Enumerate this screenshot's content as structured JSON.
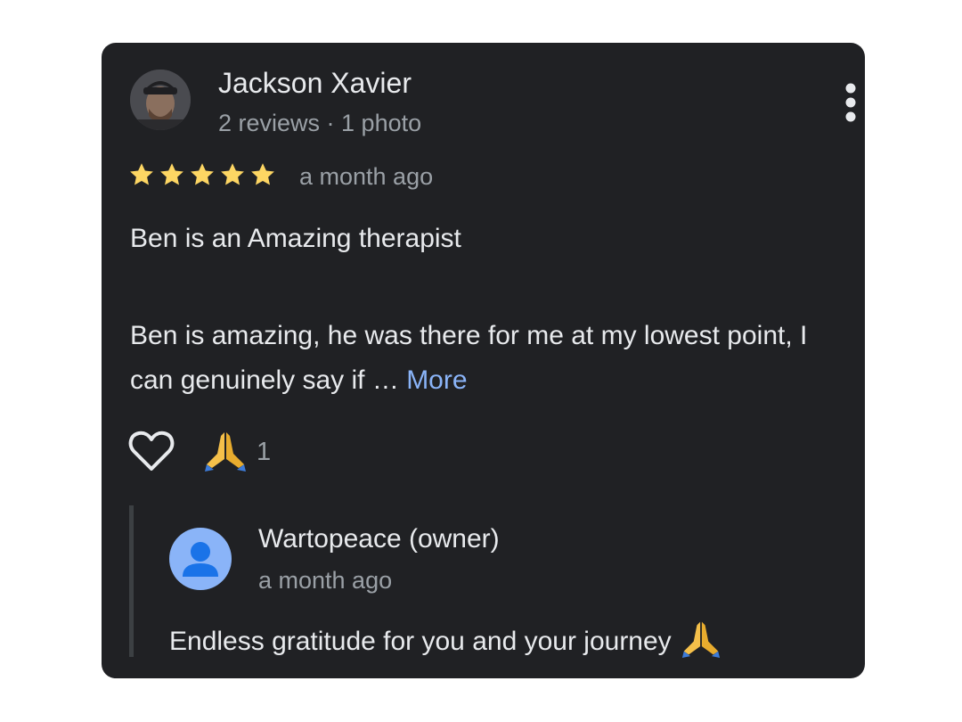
{
  "review": {
    "reviewer_name": "Jackson Xavier",
    "reviewer_meta": "2 reviews · 1 photo",
    "rating": 5,
    "time": "a month ago",
    "title": "Ben is an Amazing therapist",
    "body": "Ben is amazing, he was there for me at my lowest point, I can genuinely say if …",
    "more_label": "More",
    "reaction_count": "1",
    "icons": {
      "menu": "more-vert-icon",
      "like": "heart-outline-icon",
      "reaction": "praying-hands-icon",
      "star": "star-icon"
    }
  },
  "owner_response": {
    "name": "Wartopeace (owner)",
    "time": "a month ago",
    "text": "Endless gratitude for you and your journey"
  },
  "colors": {
    "card_background": "#202124",
    "star": "#fdd663",
    "link": "#8ab4f8",
    "primary_text": "#e8eaed",
    "secondary_text": "#9aa0a6",
    "owner_avatar": "#8ab4f8"
  }
}
